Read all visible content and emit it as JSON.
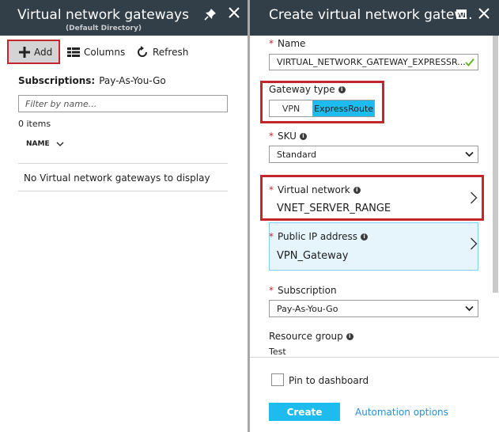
{
  "left_blade": {
    "title": "Virtual network gateways",
    "subtitle": "(Default Directory)",
    "toolbar": {
      "add_label": "Add",
      "columns_label": "Columns",
      "refresh_label": "Refresh"
    },
    "subscriptions_label": "Subscriptions:",
    "subscriptions_value": "Pay-As-You-Go",
    "filter_placeholder": "Filter by name...",
    "items_count": "0 items",
    "column_header": "NAME",
    "empty_message": "No Virtual network gateways to display"
  },
  "right_blade": {
    "title": "Create virtual network gatew..",
    "name": {
      "label": "Name",
      "value": "VIRTUAL_NETWORK_GATEWAY_EXPRESSR..."
    },
    "gateway_type": {
      "label": "Gateway type",
      "options": [
        "VPN",
        "ExpressRoute"
      ],
      "selected": "ExpressRoute"
    },
    "sku": {
      "label": "SKU",
      "value": "Standard"
    },
    "virtual_network": {
      "label": "Virtual network",
      "value": "VNET_SERVER_RANGE"
    },
    "public_ip": {
      "label": "Public IP address",
      "value": "VPN_Gateway"
    },
    "subscription": {
      "label": "Subscription",
      "value": "Pay-As-You-Go"
    },
    "resource_group": {
      "label": "Resource group",
      "value": "Test"
    },
    "footer": {
      "pin_label": "Pin to dashboard",
      "pin_checked": false,
      "create_label": "Create",
      "automation_label": "Automation options"
    }
  },
  "colors": {
    "header_bg": "#333f48",
    "accent": "#1ebbee",
    "highlight_border": "#c4262e",
    "selected_bg": "#e5f5fb",
    "link": "#2a8fd4"
  }
}
